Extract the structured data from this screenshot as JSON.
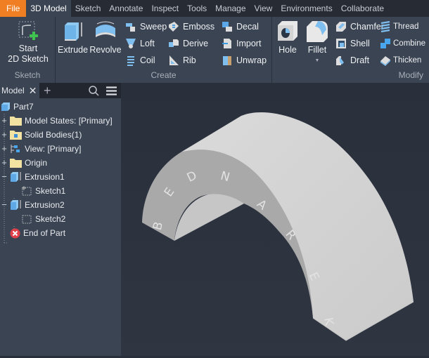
{
  "tabs": [
    {
      "label": "File"
    },
    {
      "label": "3D Model"
    },
    {
      "label": "Sketch"
    },
    {
      "label": "Annotate"
    },
    {
      "label": "Inspect"
    },
    {
      "label": "Tools"
    },
    {
      "label": "Manage"
    },
    {
      "label": "View"
    },
    {
      "label": "Environments"
    },
    {
      "label": "Collaborate"
    }
  ],
  "active_tab": "3D Model",
  "ribbon": {
    "sketch_panel": {
      "label": "Sketch",
      "start_line1": "Start",
      "start_line2": "2D Sketch"
    },
    "create_panel": {
      "label": "Create",
      "extrude": "Extrude",
      "revolve": "Revolve",
      "sweep": "Sweep",
      "loft": "Loft",
      "coil": "Coil",
      "emboss": "Emboss",
      "derive": "Derive",
      "rib": "Rib",
      "decal": "Decal",
      "import": "Import",
      "unwrap": "Unwrap"
    },
    "modify_panel": {
      "label": "Modify",
      "hole": "Hole",
      "fillet": "Fillet",
      "chamfer": "Chamfer",
      "shell": "Shell",
      "draft": "Draft",
      "thread": "Thread",
      "combine": "Combine",
      "thicken": "Thicken"
    }
  },
  "browser": {
    "tab_label": "Model",
    "items": [
      {
        "label": "Part7"
      },
      {
        "label": "Model States: [Primary]"
      },
      {
        "label": "Solid Bodies(1)"
      },
      {
        "label": "View: [Primary]"
      },
      {
        "label": "Origin"
      },
      {
        "label": "Extrusion1"
      },
      {
        "label": "Sketch1"
      },
      {
        "label": "Extrusion2"
      },
      {
        "label": "Sketch2"
      },
      {
        "label": "End of Part"
      }
    ]
  },
  "model": {
    "emboss_letters": [
      "B",
      "E",
      "D",
      "N",
      "A",
      "R",
      "E",
      "K"
    ]
  },
  "colors": {
    "accent_file": "#ef7f22",
    "ribbon_bg": "#3b4453",
    "viewport_bg": "#2a303b"
  }
}
